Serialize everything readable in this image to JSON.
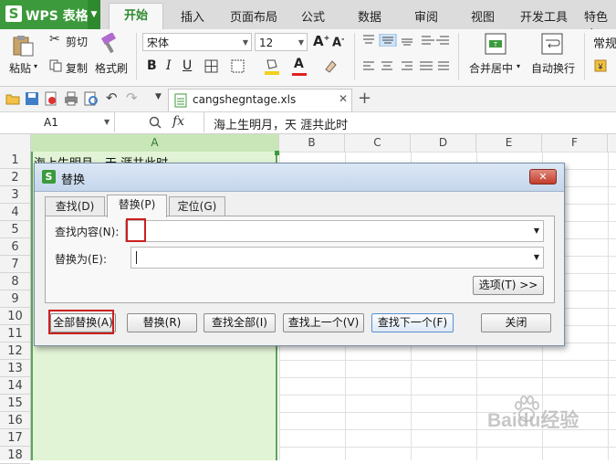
{
  "app": {
    "name": "WPS 表格"
  },
  "menu_tabs": [
    "开始",
    "插入",
    "页面布局",
    "公式",
    "数据",
    "审阅",
    "视图",
    "开发工具",
    "特色功"
  ],
  "ribbon": {
    "paste": "粘贴",
    "cut": "剪切",
    "copy": "复制",
    "format_painter": "格式刷",
    "font_name": "宋体",
    "font_size": "12",
    "merge_center": "合并居中",
    "wrap_text": "自动换行",
    "number_format": "常规"
  },
  "file_tab": {
    "name": "cangshegntage.xls"
  },
  "formula_bar": {
    "cell_ref": "A1",
    "fx": "fx",
    "content": "海上生明月，天  涯共此时"
  },
  "grid": {
    "columns": [
      "A",
      "B",
      "C",
      "D",
      "E",
      "F"
    ],
    "rows": [
      "1",
      "2",
      "3",
      "4",
      "5",
      "6",
      "7",
      "8",
      "9",
      "10",
      "11",
      "12",
      "13",
      "14",
      "15",
      "16",
      "17",
      "18"
    ],
    "a1_value": "海上生明月，天  涯共此时"
  },
  "dialog": {
    "title": "替换",
    "tabs": [
      "查找(D)",
      "替换(P)",
      "定位(G)"
    ],
    "find_label": "查找内容(N):",
    "find_value": "",
    "replace_label": "替换为(E):",
    "replace_value": "",
    "options_button": "选项(T) >>",
    "buttons": {
      "replace_all": "全部替换(A)",
      "replace": "替换(R)",
      "find_all": "查找全部(I)",
      "find_prev": "查找上一个(V)",
      "find_next": "查找下一个(F)",
      "close": "关闭"
    }
  },
  "watermark": "Baidu经验",
  "colors": {
    "accent_green": "#3c9a3c",
    "highlight_red": "#cc1f1f",
    "close_red": "#c9483c"
  }
}
